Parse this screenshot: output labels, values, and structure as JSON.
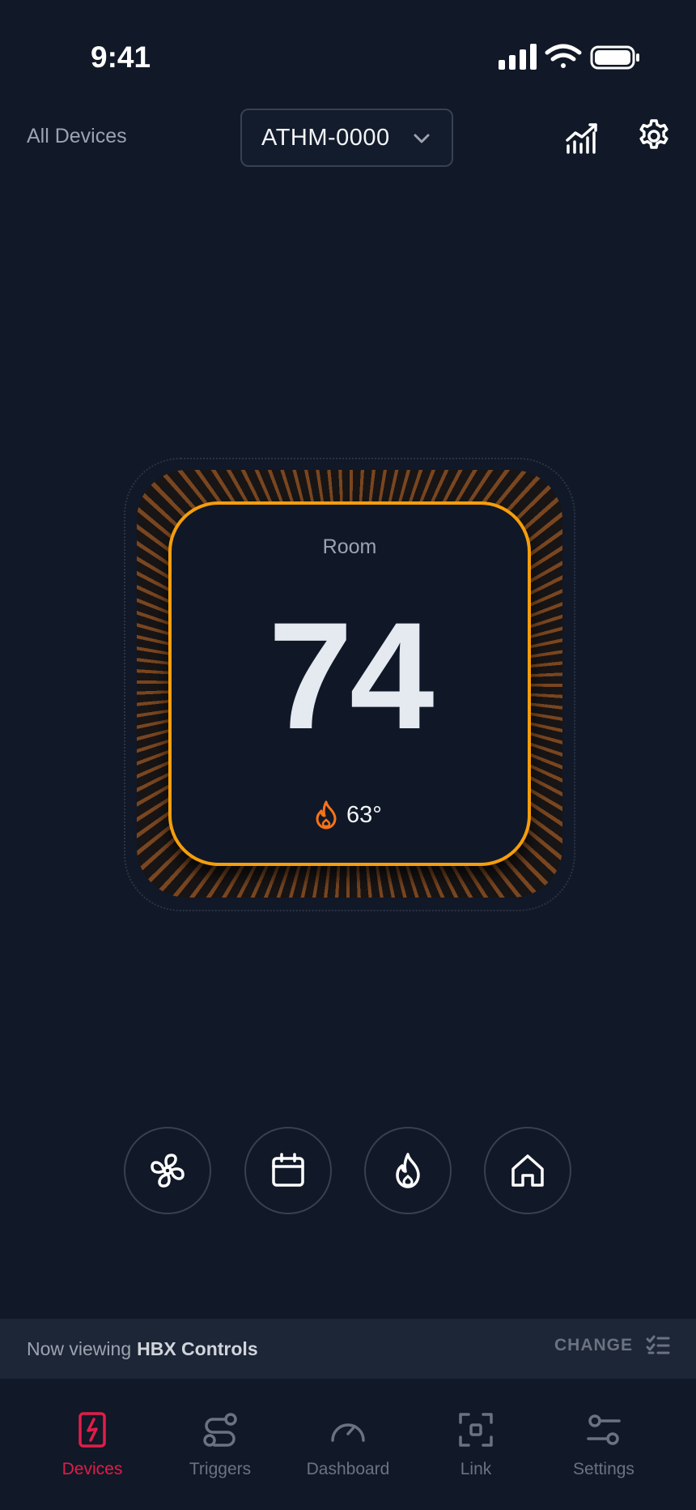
{
  "status_bar": {
    "time": "9:41"
  },
  "header": {
    "all_devices_label": "All Devices",
    "device_selector": {
      "value": "ATHM-0000"
    }
  },
  "thermostat": {
    "label": "Room",
    "current_temp": "74",
    "setpoint": "63°",
    "mode": "heat",
    "accent_color": "#f59e0b"
  },
  "modes": [
    {
      "name": "fan-icon"
    },
    {
      "name": "calendar-icon"
    },
    {
      "name": "flame-icon"
    },
    {
      "name": "home-icon"
    }
  ],
  "viewing_bar": {
    "prefix": "Now viewing ",
    "strong": "HBX Controls",
    "change_label": "CHANGE"
  },
  "tabbar": {
    "active_color": "#e11d48",
    "items": [
      {
        "label": "Devices",
        "icon": "device-bolt-icon",
        "active": true
      },
      {
        "label": "Triggers",
        "icon": "triggers-icon",
        "active": false
      },
      {
        "label": "Dashboard",
        "icon": "gauge-icon",
        "active": false
      },
      {
        "label": "Link",
        "icon": "scan-icon",
        "active": false
      },
      {
        "label": "Settings",
        "icon": "sliders-icon",
        "active": false
      }
    ]
  }
}
